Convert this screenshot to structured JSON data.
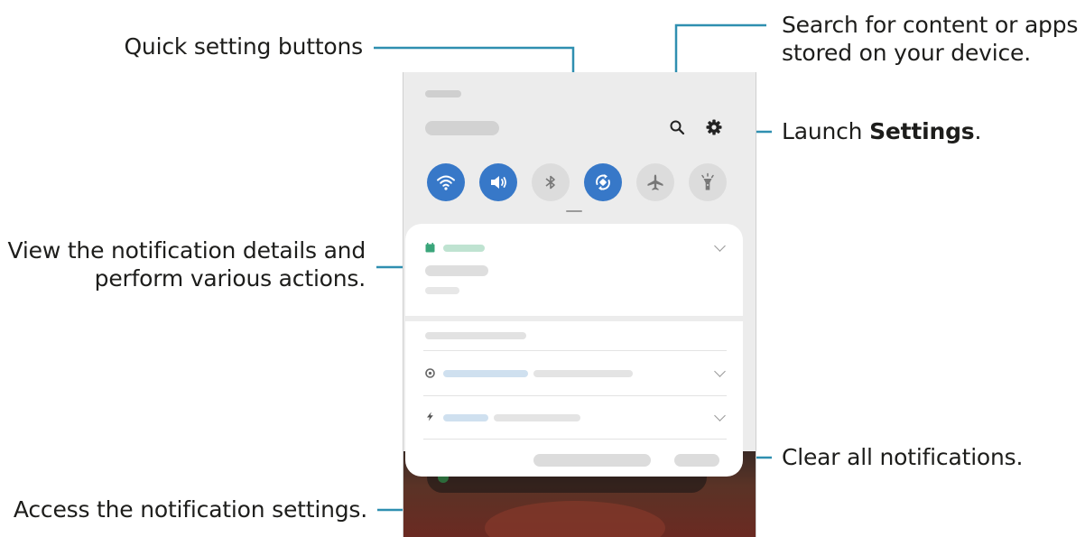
{
  "callouts": {
    "quick_settings": "Quick setting buttons",
    "search_line1": "Search for content or apps",
    "search_line2": "stored on your device.",
    "settings_prefix": "Launch ",
    "settings_bold": "Settings",
    "settings_suffix": ".",
    "notification_line1": "View the notification details and",
    "notification_line2": "perform various actions.",
    "clear_all": "Clear all notifications.",
    "notification_settings": "Access the notification settings."
  },
  "quick_buttons": [
    {
      "name": "wifi",
      "icon": "wifi-icon",
      "state": "on"
    },
    {
      "name": "sound",
      "icon": "sound-icon",
      "state": "on"
    },
    {
      "name": "bluetooth",
      "icon": "bluetooth-icon",
      "state": "off"
    },
    {
      "name": "auto-rotate",
      "icon": "auto-rotate-icon",
      "state": "on"
    },
    {
      "name": "airplane-mode",
      "icon": "airplane-icon",
      "state": "off"
    },
    {
      "name": "flashlight",
      "icon": "flashlight-icon",
      "state": "off"
    }
  ],
  "colors": {
    "accent": "#3778c8",
    "leader_line": "#2f8fb0",
    "notification_app": "#3aa57a"
  }
}
